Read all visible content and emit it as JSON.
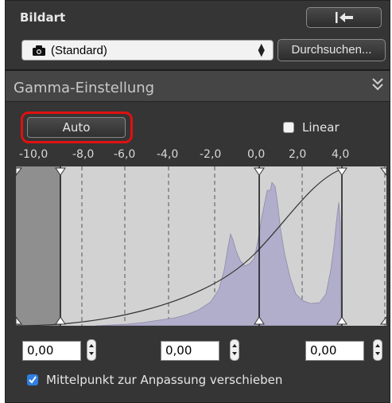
{
  "picture_style": {
    "label": "Bildart",
    "selected": "(Standard)",
    "browse_label": "Durchsuchen..."
  },
  "gamma": {
    "title": "Gamma-Einstellung",
    "auto_label": "Auto",
    "linear_label": "Linear",
    "linear_checked": false,
    "axis_ticks": [
      "-10,0",
      "-8,0",
      "-6,0",
      "-4,0",
      "-2,0",
      "0,0",
      "2,0",
      "4,0"
    ],
    "field_left": "0,00",
    "field_mid": "0,00",
    "field_right": "0,00",
    "midpoint_label": "Mittelpunkt zur Anpassung verschieben",
    "midpoint_checked": true
  },
  "colors": {
    "panel": "#353535",
    "highlight": "#e01010",
    "histogram_fill": "#b1aecb",
    "checkbox": "#2f7fe2"
  }
}
